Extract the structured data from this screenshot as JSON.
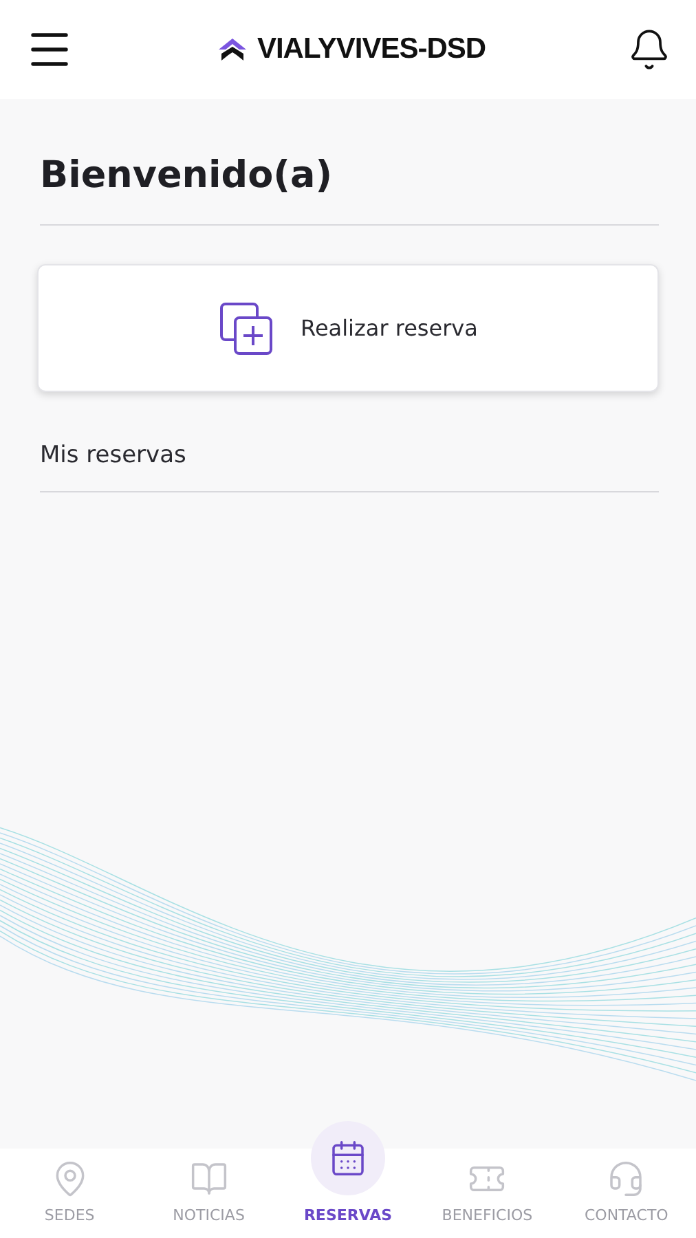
{
  "header": {
    "brand": "VIALYVIVES-DSD"
  },
  "greeting": "Bienvenido(a)",
  "action_card": {
    "label": "Realizar reserva"
  },
  "section_title": "Mis reservas",
  "nav": [
    {
      "label": "SEDES",
      "selected": false
    },
    {
      "label": "NOTICIAS",
      "selected": false
    },
    {
      "label": "RESERVAS",
      "selected": true
    },
    {
      "label": "BENEFICIOS",
      "selected": false
    },
    {
      "label": "CONTACTO",
      "selected": false
    }
  ]
}
